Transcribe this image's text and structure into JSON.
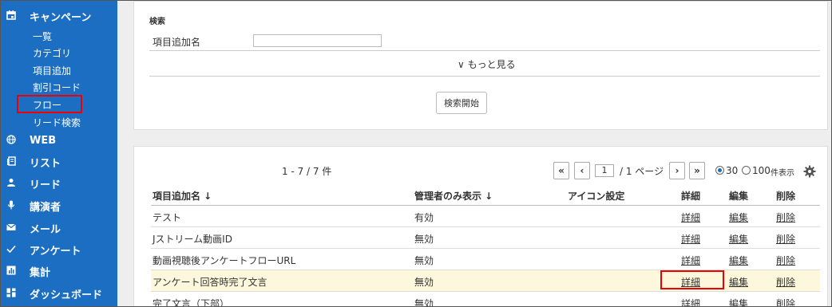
{
  "sidebar": {
    "campaign": {
      "label": "キャンペーン",
      "icon": "calendar-icon"
    },
    "sub_items": [
      "一覧",
      "カテゴリ",
      "項目追加",
      "割引コード",
      "フロー",
      "リード検索"
    ],
    "sections": [
      {
        "label": "WEB",
        "icon": "globe-icon"
      },
      {
        "label": "リスト",
        "icon": "list-icon"
      },
      {
        "label": "リード",
        "icon": "person-icon"
      },
      {
        "label": "講演者",
        "icon": "microphone-icon"
      },
      {
        "label": "メール",
        "icon": "mail-icon"
      },
      {
        "label": "アンケート",
        "icon": "check-icon"
      },
      {
        "label": "集計",
        "icon": "bar-chart-icon"
      },
      {
        "label": "ダッシュボード",
        "icon": "dashboard-icon"
      }
    ]
  },
  "search": {
    "title": "検索",
    "field_label": "項目追加名",
    "field_value": "",
    "more_label": "∨ もっと見る",
    "submit_label": "検索開始"
  },
  "list": {
    "count_label": "1 - 7 / 7 件",
    "pagination": {
      "first": "«",
      "prev": "‹",
      "page": "1",
      "page_suffix": "/ 1 ページ",
      "next": "›",
      "last": "»"
    },
    "per_page": {
      "opt1": "30",
      "opt2": "100",
      "suffix": "件表示",
      "selected": "30"
    },
    "headers": [
      "項目追加名 ↓",
      "管理者のみ表示 ↓",
      "アイコン設定",
      "詳細",
      "編集",
      "削除"
    ],
    "rows": [
      {
        "name": "テスト",
        "admin": "有効",
        "detail": "詳細",
        "edit": "編集",
        "delete": "削除"
      },
      {
        "name": "Jストリーム動画ID",
        "admin": "無効",
        "detail": "詳細",
        "edit": "編集",
        "delete": "削除"
      },
      {
        "name": "動画視聴後アンケートフローURL",
        "admin": "無効",
        "detail": "詳細",
        "edit": "編集",
        "delete": "削除"
      },
      {
        "name": "アンケート回答時完了文言",
        "admin": "無効",
        "detail": "詳細",
        "edit": "編集",
        "delete": "削除"
      },
      {
        "name": "完了文言（下部）",
        "admin": "無効",
        "detail": "詳細",
        "edit": "編集",
        "delete": "削除"
      }
    ]
  },
  "colors": {
    "sidebar": "#1b6ec2",
    "highlight_row": "#fdf8dc",
    "annotation": "#e00000"
  }
}
